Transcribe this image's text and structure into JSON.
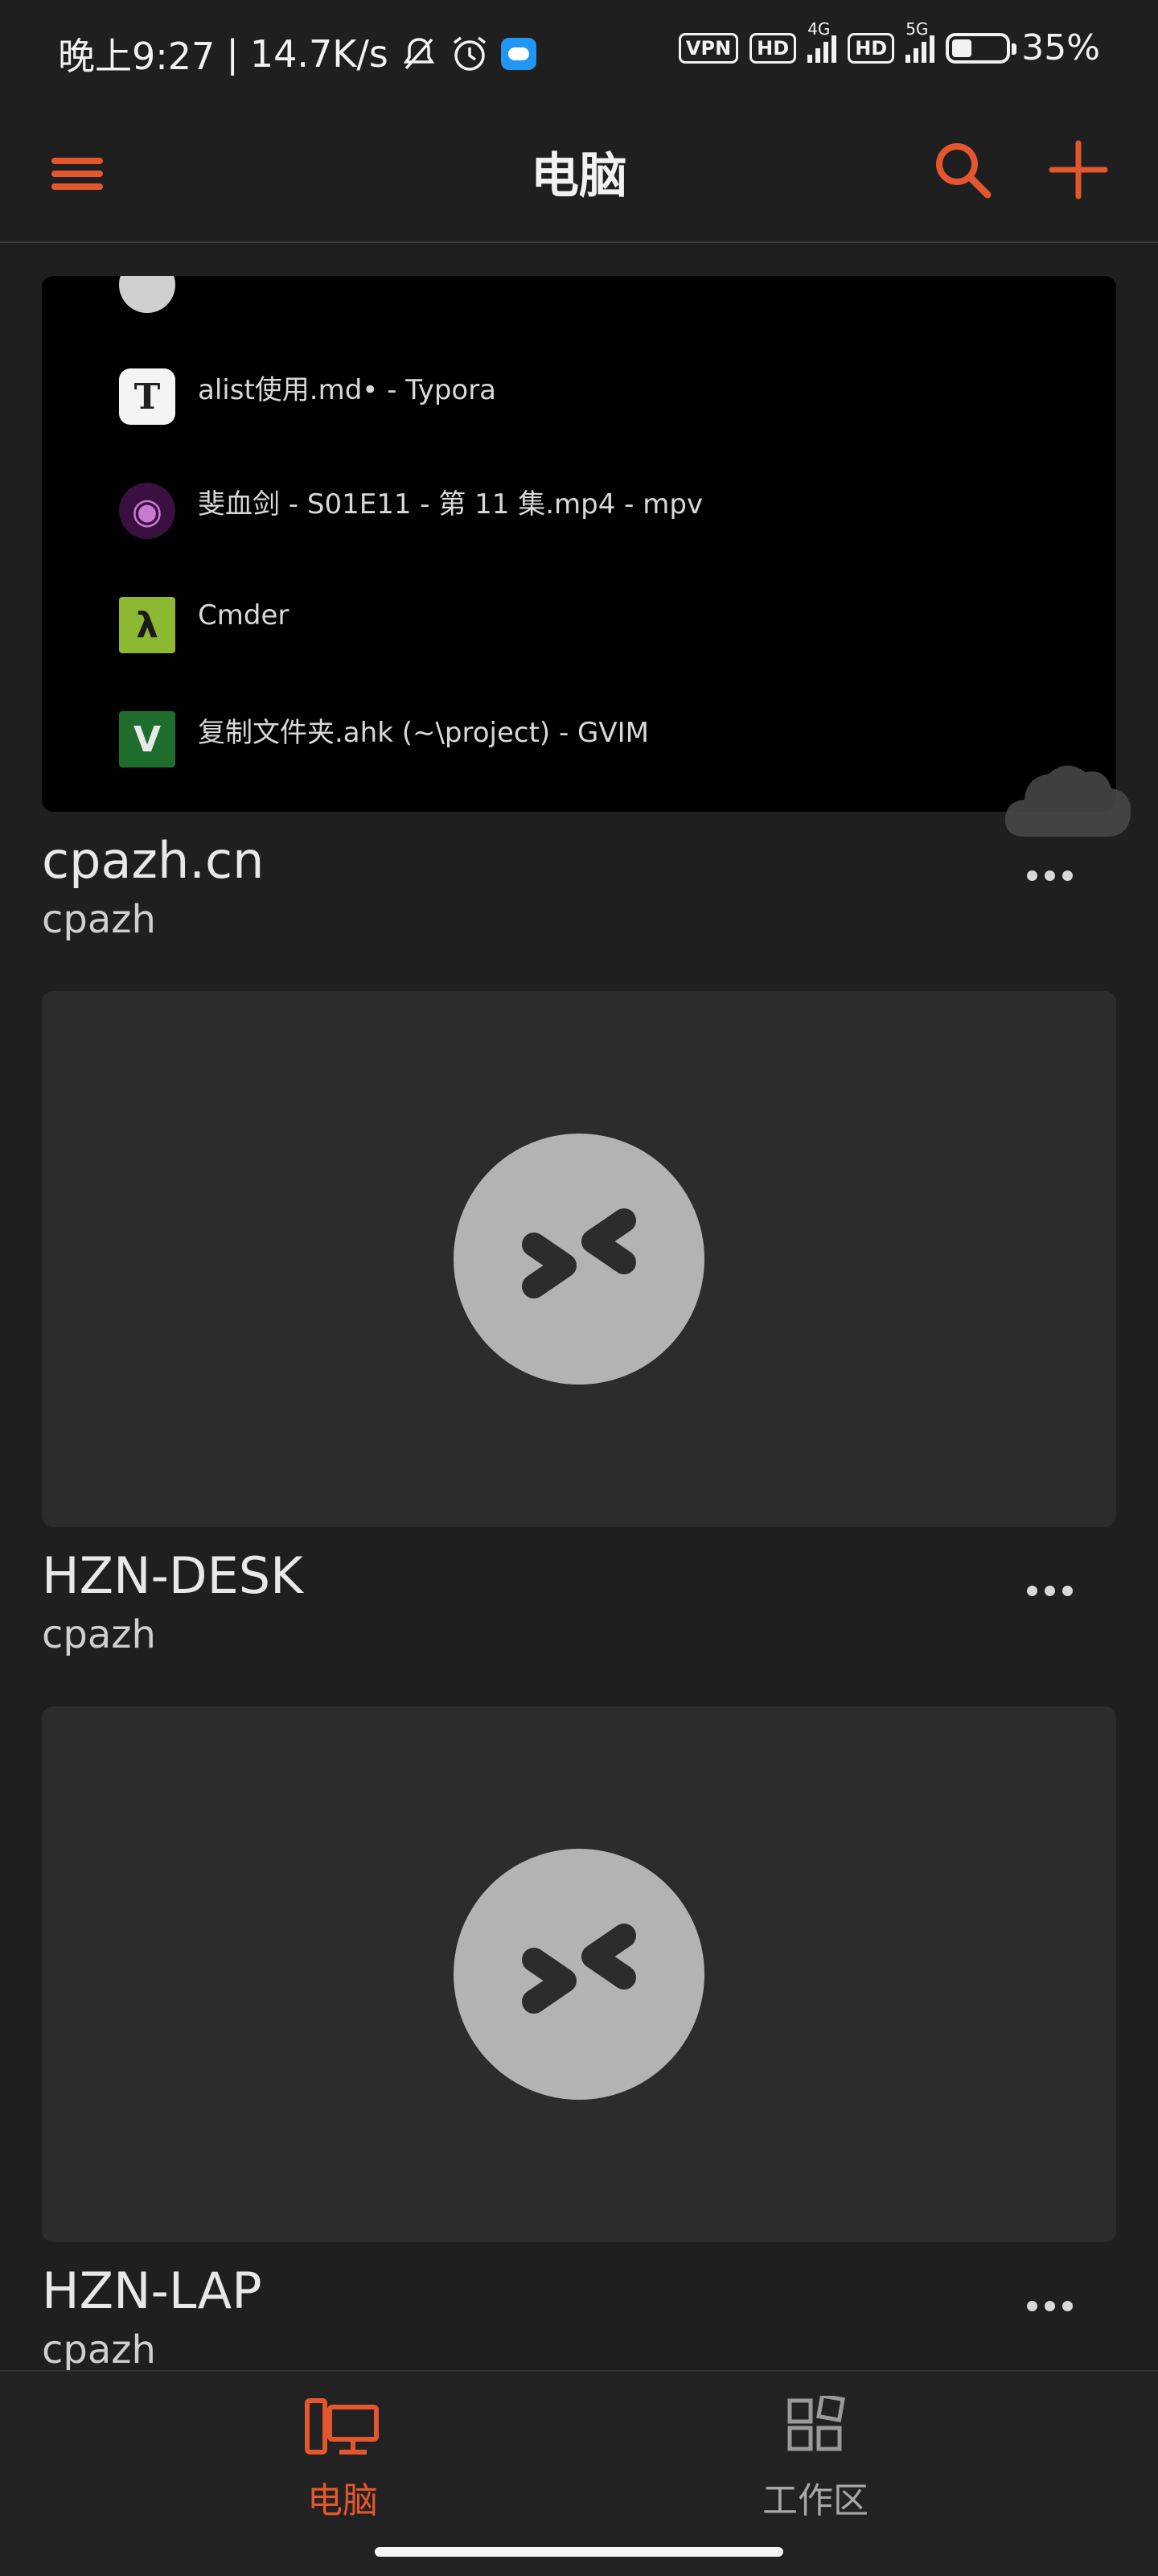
{
  "status_bar": {
    "time": "晚上9:27",
    "separator": "|",
    "speed": "14.7K/s",
    "vpn": "VPN",
    "hd1": "HD",
    "net1": "4G",
    "hd2": "HD",
    "net2": "5G",
    "battery": "35%"
  },
  "header": {
    "title": "电脑"
  },
  "preview_windows": [
    {
      "icon_letter": "T",
      "label": "alist使用.md• - Typora"
    },
    {
      "icon_letter": "◉",
      "label": "斐血剑 - S01E11 - 第 11 集.mp4 - mpv"
    },
    {
      "icon_letter": "λ",
      "label": "Cmder"
    },
    {
      "icon_letter": "V",
      "label": "复制文件夹.ahk (~\\project) - GVIM"
    }
  ],
  "pcs": [
    {
      "name": "cpazh.cn",
      "user": "cpazh"
    },
    {
      "name": "HZN-DESK",
      "user": "cpazh"
    },
    {
      "name": "HZN-LAP",
      "user": "cpazh"
    }
  ],
  "bottom_nav": {
    "items": [
      {
        "label": "电脑",
        "active": true
      },
      {
        "label": "工作区",
        "active": false
      }
    ]
  },
  "colors": {
    "accent": "#e4572e",
    "background": "#1f1f1f",
    "card": "#2b2c2e",
    "logo": "#b3b3b3"
  }
}
